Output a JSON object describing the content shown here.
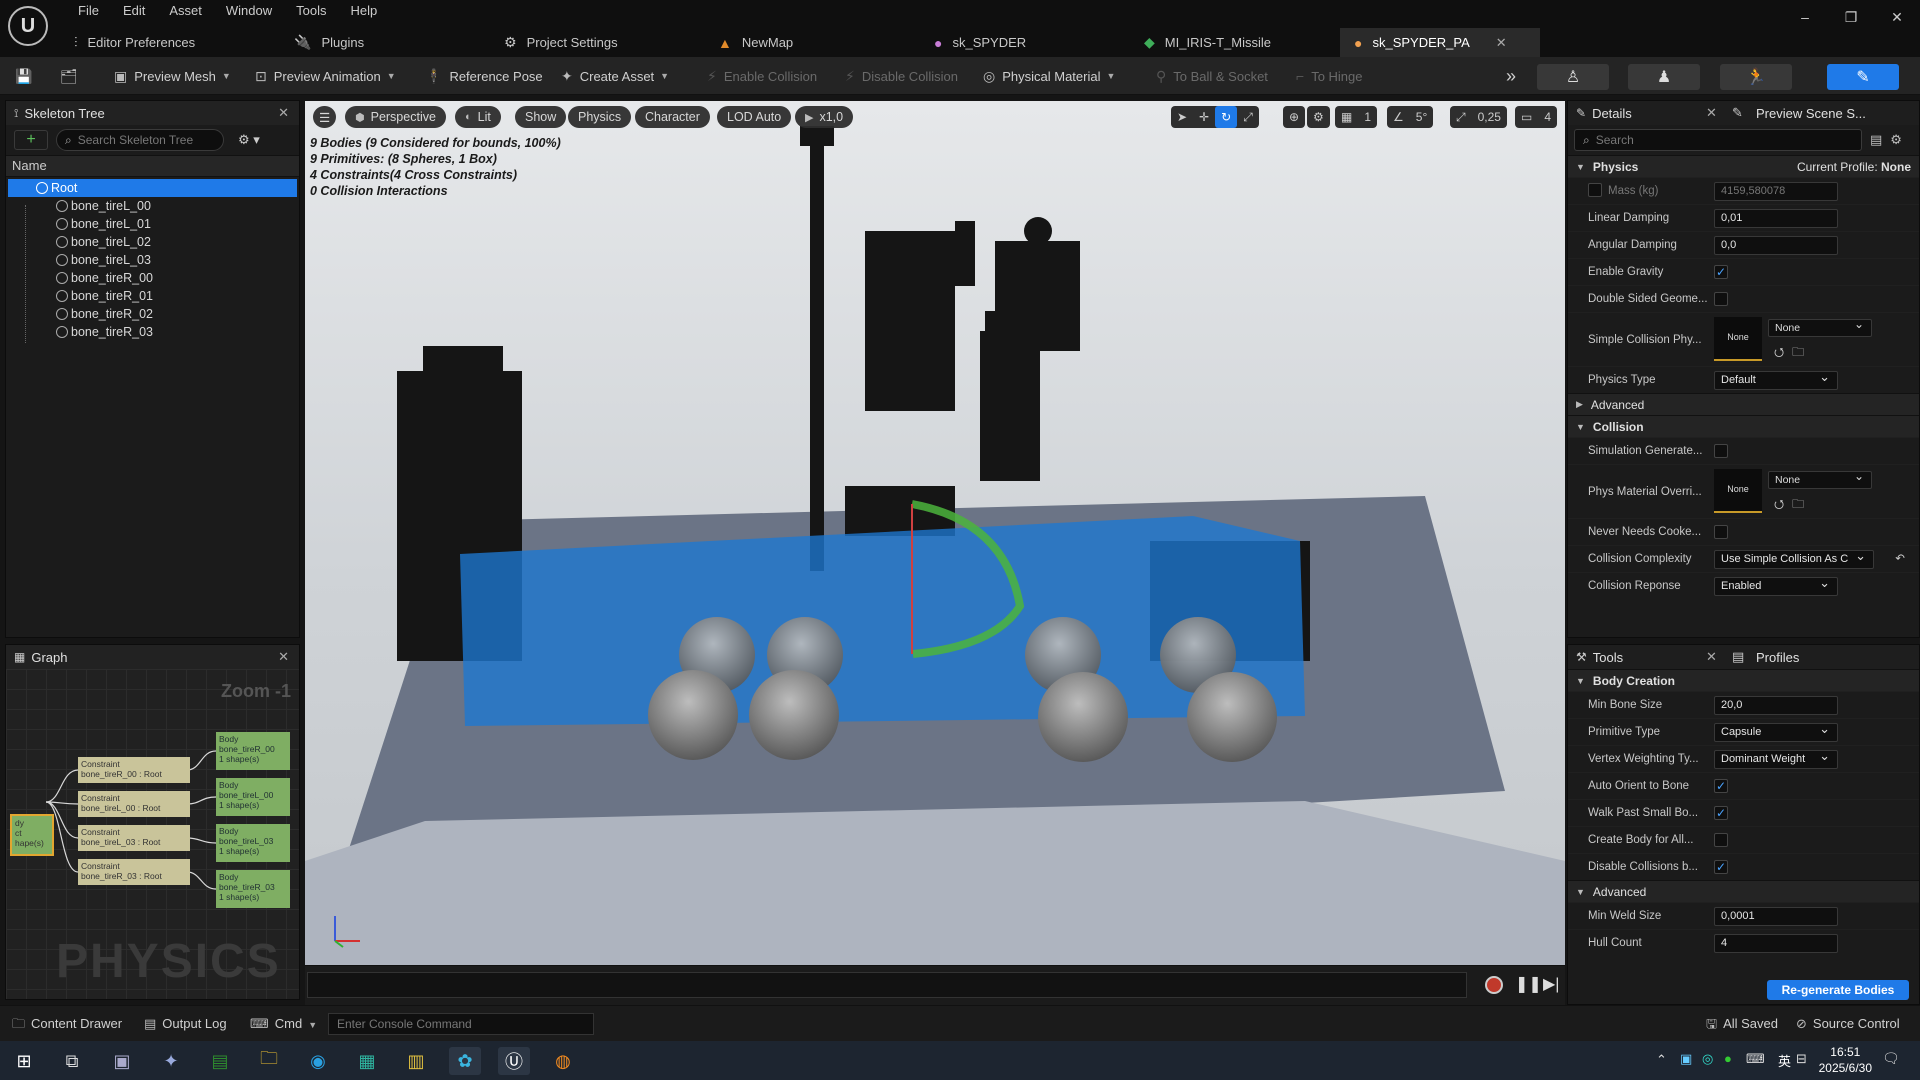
{
  "menu": [
    "File",
    "Edit",
    "Asset",
    "Window",
    "Tools",
    "Help"
  ],
  "tabs": [
    {
      "label": "Editor Preferences",
      "icon": "sliders-icon"
    },
    {
      "label": "Plugins",
      "icon": "plug-icon"
    },
    {
      "label": "Project Settings",
      "icon": "gear-icon"
    },
    {
      "label": "NewMap",
      "icon": "map-icon"
    },
    {
      "label": "sk_SPYDER",
      "icon": "skeleton-icon"
    },
    {
      "label": "MI_IRIS-T_Missile",
      "icon": "material-icon"
    },
    {
      "label": "sk_SPYDER_PA",
      "icon": "physics-asset-icon",
      "active": true
    }
  ],
  "toolbar": {
    "preview_mesh": "Preview Mesh",
    "preview_animation": "Preview Animation",
    "reference_pose": "Reference Pose",
    "create_asset": "Create Asset",
    "enable_collision": "Enable Collision",
    "disable_collision": "Disable Collision",
    "physical_material": "Physical Material",
    "to_ball_socket": "To Ball & Socket",
    "to_hinge": "To Hinge"
  },
  "skeleton_tree": {
    "title": "Skeleton Tree",
    "search_placeholder": "Search Skeleton Tree",
    "column": "Name",
    "root": "Root",
    "bones": [
      "bone_tireL_00",
      "bone_tireL_01",
      "bone_tireL_02",
      "bone_tireL_03",
      "bone_tireR_00",
      "bone_tireR_01",
      "bone_tireR_02",
      "bone_tireR_03"
    ]
  },
  "graph": {
    "title": "Graph",
    "zoom": "Zoom -1",
    "watermark": "PHYSICS",
    "root_node": "dy\nct\nhape(s)",
    "constraints": [
      {
        "line1": "Constraint",
        "line2": "bone_tireR_00 : Root"
      },
      {
        "line1": "Constraint",
        "line2": "bone_tireL_00 : Root"
      },
      {
        "line1": "Constraint",
        "line2": "bone_tireL_03 : Root"
      },
      {
        "line1": "Constraint",
        "line2": "bone_tireR_03 : Root"
      }
    ],
    "bodies": [
      {
        "line1": "Body",
        "line2": "bone_tireR_00",
        "line3": "1 shape(s)"
      },
      {
        "line1": "Body",
        "line2": "bone_tireL_00",
        "line3": "1 shape(s)"
      },
      {
        "line1": "Body",
        "line2": "bone_tireL_03",
        "line3": "1 shape(s)"
      },
      {
        "line1": "Body",
        "line2": "bone_tireR_03",
        "line3": "1 shape(s)"
      }
    ]
  },
  "viewport": {
    "perspective": "Perspective",
    "lit": "Lit",
    "show": "Show",
    "physics": "Physics",
    "character": "Character",
    "lod": "LOD Auto",
    "speed": "x1,0",
    "grid_snap": "1",
    "angle_snap": "5°",
    "scale_snap": "0,25",
    "camera_speed": "4",
    "stats": [
      "9 Bodies (9 Considered for bounds, 100%)",
      "9 Primitives: (8 Spheres, 1 Box)",
      "4 Constraints(4 Cross Constraints)",
      "0 Collision Interactions"
    ]
  },
  "details": {
    "title": "Details",
    "preview_scene": "Preview Scene S...",
    "search_placeholder": "Search",
    "physics_section": "Physics",
    "current_profile_label": "Current Profile:",
    "current_profile_value": "None",
    "mass_label": "Mass (kg)",
    "mass_value": "4159,580078",
    "linear_damping_label": "Linear Damping",
    "linear_damping_value": "0,01",
    "angular_damping_label": "Angular Damping",
    "angular_damping_value": "0,0",
    "enable_gravity_label": "Enable Gravity",
    "double_sided_label": "Double Sided Geome...",
    "simple_collision_label": "Simple Collision Phy...",
    "thumb_none": "None",
    "none_dd": "None",
    "physics_type_label": "Physics Type",
    "physics_type_value": "Default",
    "advanced": "Advanced",
    "collision_section": "Collision",
    "sim_generate_label": "Simulation Generate...",
    "phys_mat_override_label": "Phys Material Overri...",
    "never_needs_cooked_label": "Never Needs Cooke...",
    "collision_complexity_label": "Collision Complexity",
    "collision_complexity_value": "Use Simple Collision As C",
    "collision_response_label": "Collision Reponse",
    "collision_response_value": "Enabled"
  },
  "tools": {
    "title": "Tools",
    "profiles": "Profiles",
    "body_creation": "Body Creation",
    "min_bone_size_label": "Min Bone Size",
    "min_bone_size_value": "20,0",
    "primitive_type_label": "Primitive Type",
    "primitive_type_value": "Capsule",
    "vertex_weighting_label": "Vertex Weighting Ty...",
    "vertex_weighting_value": "Dominant Weight",
    "auto_orient_label": "Auto Orient to Bone",
    "walk_past_label": "Walk Past Small Bo...",
    "create_body_all_label": "Create Body for All...",
    "disable_collisions_label": "Disable Collisions b...",
    "advanced": "Advanced",
    "min_weld_label": "Min Weld Size",
    "min_weld_value": "0,0001",
    "hull_count_label": "Hull Count",
    "hull_count_value": "4",
    "regenerate": "Re-generate Bodies"
  },
  "statusbar": {
    "content_drawer": "Content Drawer",
    "output_log": "Output Log",
    "cmd": "Cmd",
    "console_placeholder": "Enter Console Command",
    "all_saved": "All Saved",
    "source_control": "Source Control"
  },
  "taskbar": {
    "time": "16:51",
    "date": "2025/6/30",
    "ime": "英"
  },
  "colors": {
    "accent": "#1f7ae8",
    "panel": "#1b1b1b",
    "constraint_node": "#c9c49a",
    "body_node": "#7fae63",
    "collision_box": "#1e78d2"
  }
}
